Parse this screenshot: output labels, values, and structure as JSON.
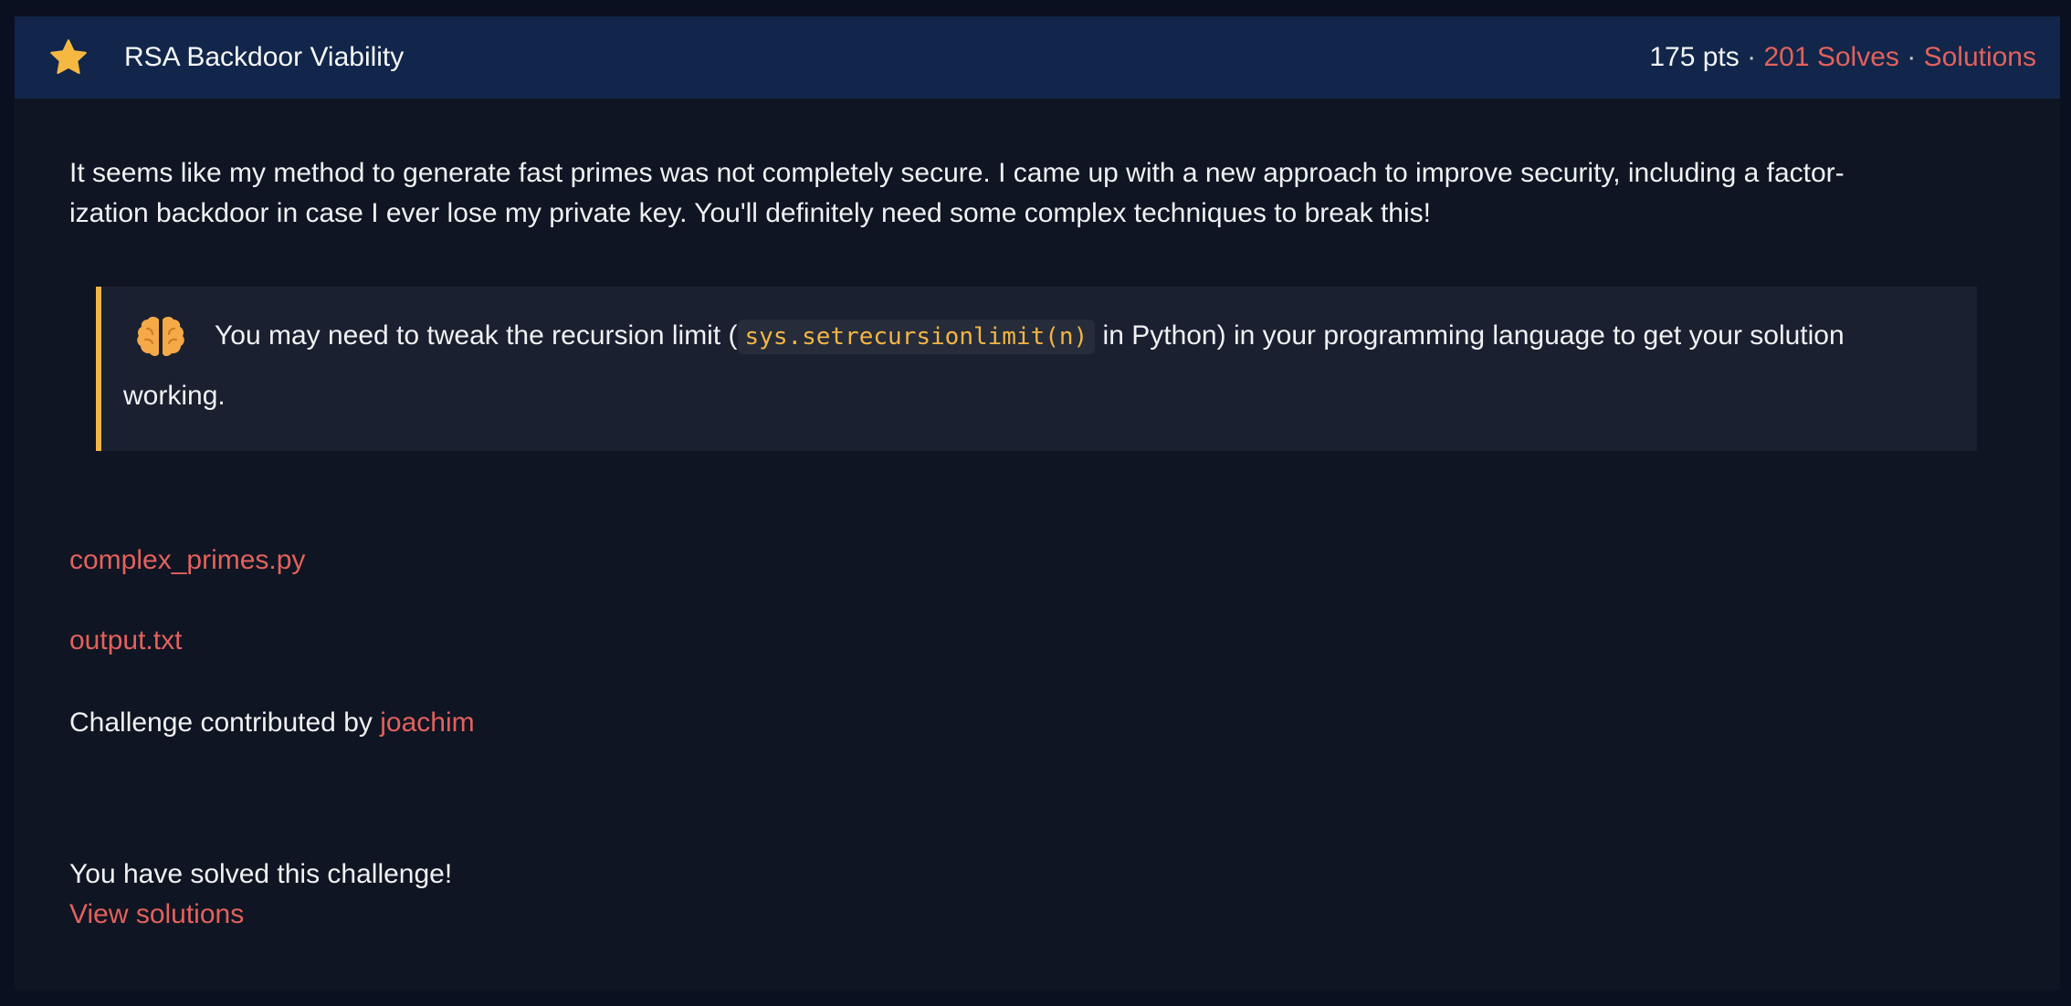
{
  "header": {
    "icon": "star-icon",
    "title": "RSA Backdoor Viability",
    "points": "175 pts",
    "separator": "·",
    "solves_label": "201 Solves",
    "solutions_label": "Solutions"
  },
  "description": {
    "line1": "It seems like my method to generate fast primes was not completely secure. I came up with a new approach to improve security, including a factor-",
    "line2": "ization backdoor in case I ever lose my private key. You'll definitely need some complex techniques to break this!"
  },
  "tip": {
    "icon": "brain-icon",
    "text_before": "You may need to tweak the recursion limit (",
    "code": "sys.setrecursionlimit(n)",
    "text_after": " in Python) in your programming language to get your solution",
    "text_line2": "working.",
    "accent_color": "#f3b545"
  },
  "files": [
    {
      "label": "complex_primes.py"
    },
    {
      "label": "output.txt"
    }
  ],
  "contributor": {
    "prefix": "Challenge contributed by ",
    "name": "joachim"
  },
  "status": {
    "message": "You have solved this challenge!",
    "view_solutions_label": "View solutions"
  },
  "colors": {
    "link": "#e3615d",
    "header_bg": "#11264a",
    "card_bg": "#0f1522",
    "page_bg": "#0b1020"
  }
}
